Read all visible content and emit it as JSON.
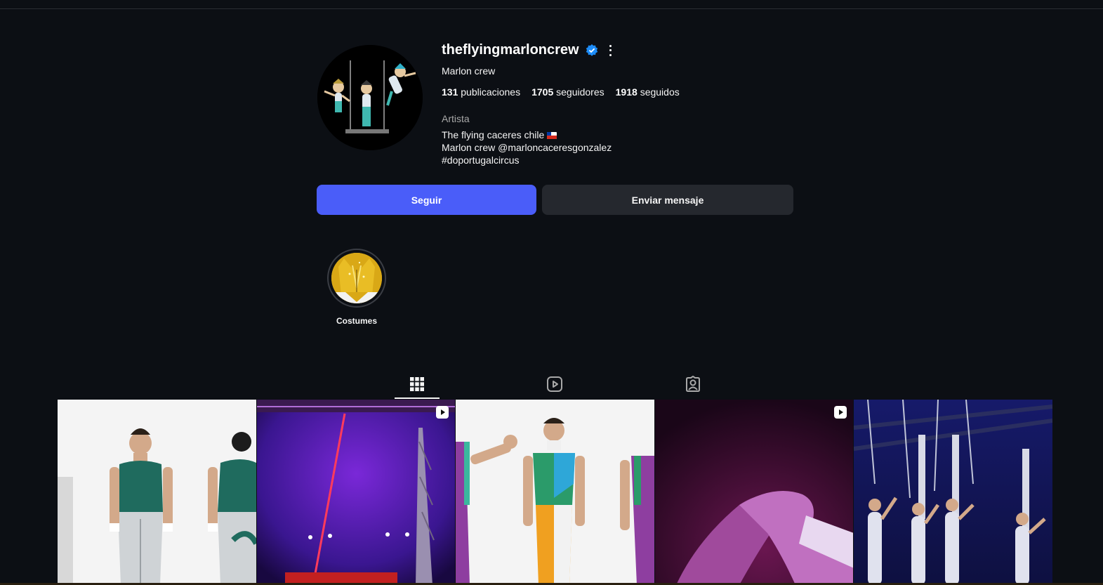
{
  "profile": {
    "username": "theflyingmarloncrew",
    "full_name": "Marlon crew",
    "category": "Artista",
    "bio_lines": [
      "The flying caceres chile",
      "Marlon crew @marloncaceresgonzalez",
      "#doportugalcircus"
    ]
  },
  "stats": {
    "posts_count": "131",
    "posts_label": "publicaciones",
    "followers_count": "1705",
    "followers_label": "seguidores",
    "following_count": "1918",
    "following_label": "seguidos"
  },
  "actions": {
    "follow_label": "Seguir",
    "message_label": "Enviar mensaje"
  },
  "highlights": [
    {
      "label": "Costumes"
    }
  ],
  "tabs": [
    {
      "icon": "grid-icon",
      "active": true
    },
    {
      "icon": "reels-icon",
      "active": false
    },
    {
      "icon": "tagged-icon",
      "active": false
    }
  ],
  "posts": [
    {
      "type": "photo",
      "subject": "acrobats green white costume"
    },
    {
      "type": "reel",
      "subject": "circus tent purple lights"
    },
    {
      "type": "photo",
      "subject": "acrobats multicolor costume"
    },
    {
      "type": "reel",
      "subject": "hands purple light"
    },
    {
      "type": "photo",
      "subject": "acrobats troupe on stage"
    }
  ],
  "colors": {
    "background": "#0c0f14",
    "follow_button": "#4a5df9",
    "message_button": "#25282e",
    "verified": "#1d8cf8"
  }
}
